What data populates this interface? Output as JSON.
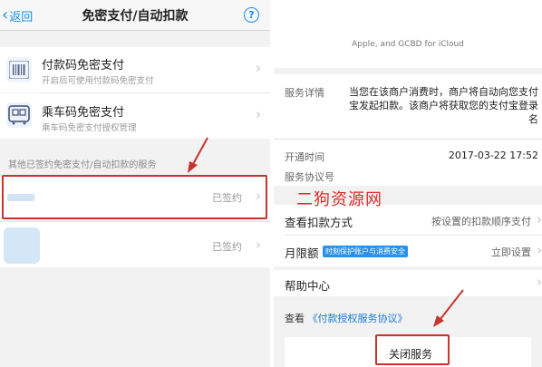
{
  "left": {
    "nav": {
      "back_label": "返回",
      "title": "免密支付/自动扣款",
      "help_glyph": "?"
    },
    "items": [
      {
        "title": "付款码免密支付",
        "subtitle": "开启后可使用付款码免密支付",
        "icon": "barcode-icon"
      },
      {
        "title": "乘车码免密支付",
        "subtitle": "乘车码免密支付授权管理",
        "icon": "bus-icon"
      }
    ],
    "section_header": "其他已签约免密支付/自动扣款的服务",
    "signed_services": [
      {
        "status": "已签约"
      },
      {
        "status": "已签约"
      }
    ]
  },
  "right": {
    "merchant_name": "Apple, and GCBD for iCloud",
    "detail_label": "服务详情",
    "detail_text_lines": [
      "当您在该商户消费时，商户将自动向您支付",
      "宝发起扣款。该商户将获取您的支付宝登录",
      "名"
    ],
    "open_time_label": "开通时间",
    "open_time_value": "2017-03-22 17:52",
    "agreement_no_label": "服务协议号",
    "watermark": "二狗资源网",
    "deduction_title": "查看扣款方式",
    "deduction_value": "按设置的扣款顺序支付",
    "limit_title": "月限额",
    "limit_tag": "时刻保护账户与消费安全",
    "limit_value": "立即设置",
    "help_title": "帮助中心",
    "view_prefix": "查看",
    "agreement_link": "《付款授权服务协议》",
    "close_button": "关闭服务"
  },
  "colors": {
    "accent": "#1a8ee8",
    "highlight_red": "#c6342c",
    "watermark_red": "#e02a2a",
    "tag_blue": "#2a90e8"
  }
}
